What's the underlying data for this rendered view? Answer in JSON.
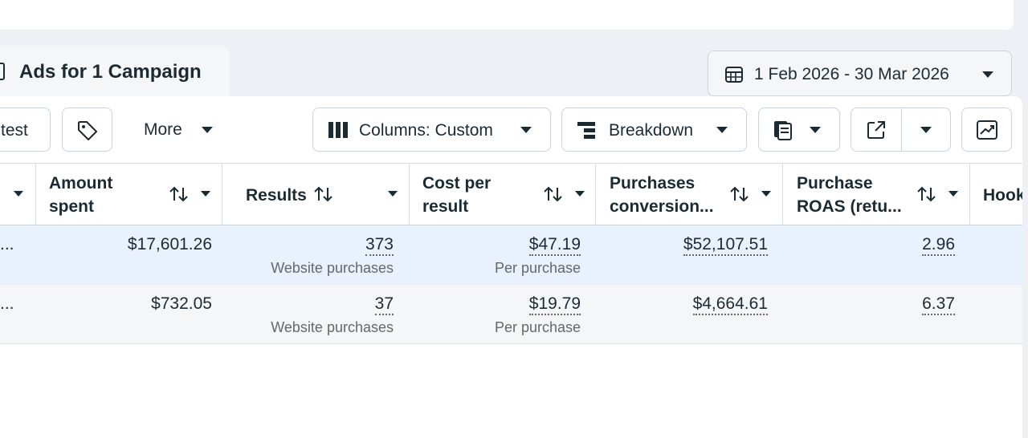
{
  "tab": {
    "label": "Ads for 1 Campaign"
  },
  "date_range": {
    "label": "1 Feb 2026 - 30 Mar 2026"
  },
  "toolbar": {
    "test_label": "test",
    "more_label": "More",
    "columns_label": "Columns: Custom",
    "breakdown_label": "Breakdown"
  },
  "columns": [
    {
      "line1": "Amount",
      "line2": "spent"
    },
    {
      "line1": "Results",
      "line2": ""
    },
    {
      "line1": "Cost per",
      "line2": "result"
    },
    {
      "line1": "Purchases",
      "line2": "conversion..."
    },
    {
      "line1": "Purchase",
      "line2": "ROAS (retu..."
    },
    {
      "line1": "Hook",
      "line2": ""
    }
  ],
  "rows": [
    {
      "lead": "...",
      "amount_spent": "$17,601.26",
      "results": "373",
      "results_sub": "Website purchases",
      "cost_per_result": "$47.19",
      "cost_sub": "Per purchase",
      "purchases_conversion": "$52,107.51",
      "roas": "2.96"
    },
    {
      "lead": "...",
      "amount_spent": "$732.05",
      "results": "37",
      "results_sub": "Website purchases",
      "cost_per_result": "$19.79",
      "cost_sub": "Per purchase",
      "purchases_conversion": "$4,664.61",
      "roas": "6.37"
    }
  ],
  "colors": {
    "text": "#1c2b33",
    "muted": "#65676b",
    "selected_row": "#e9f1fd",
    "border": "#cbd2d9"
  },
  "icons": [
    "tag-icon",
    "columns-icon",
    "breakdown-icon",
    "reports-icon",
    "export-icon",
    "chart-icon",
    "calendar-icon",
    "sort-icon",
    "chevron-down-icon"
  ]
}
